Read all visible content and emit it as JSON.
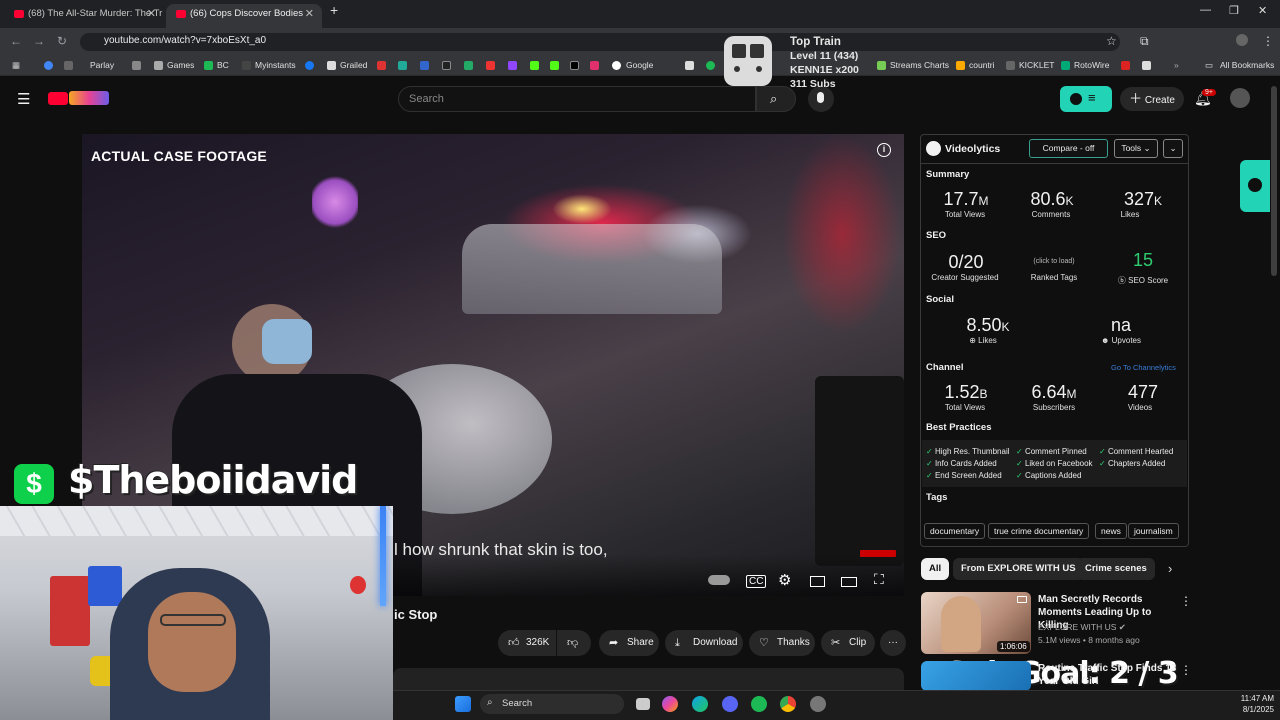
{
  "browser": {
    "tabs": [
      {
        "title": "(68) The All-Star Murder: The Tr"
      },
      {
        "title": "(66) Cops Discover Bodies"
      }
    ],
    "url": "youtube.com/watch?v=7xboEsXt_a0",
    "bookmarks": [
      "Parlay",
      "Games",
      "BC",
      "Myinstants",
      "Grailed",
      "Google",
      "Streams Charts",
      "countri",
      "KICKLET",
      "RotoWire",
      "All Bookmarks"
    ]
  },
  "overlay": {
    "train_title": "Top Train",
    "train_level": "Level 11  (434)",
    "train_user": "KENN1E x200",
    "train_subs": "311 Subs",
    "cashtag": "$Theboiidavid",
    "cashapp_symbol": "$",
    "sub_goal": "Sub Goal: 2 / 3"
  },
  "youtube": {
    "search_placeholder": "Search",
    "create_label": "Create",
    "notif_count": "9+",
    "video": {
      "case_label": "ACTUAL CASE FOOTAGE",
      "subtitle": "l how shrunk that skin is too,",
      "title_partial": "ic Stop"
    },
    "actions": {
      "likes": "326K",
      "share": "Share",
      "download": "Download",
      "thanks": "Thanks",
      "clip": "Clip"
    },
    "chips": [
      "All",
      "From EXPLORE WITH US",
      "Crime scenes"
    ],
    "recommended": [
      {
        "title": "Man Secretly Records Moments Leading Up to Killing",
        "channel": "EXPLORE WITH US",
        "meta": "5.1M views • 8 months ago",
        "duration": "1:06:06"
      },
      {
        "title": "Routine Traffic Stop Finds 13 Year Old Girl",
        "channel": "",
        "meta": "",
        "duration": ""
      }
    ]
  },
  "videolytics": {
    "brand": "Videolytics",
    "compare": "Compare - off",
    "tools": "Tools",
    "summary_h": "Summary",
    "summary": [
      {
        "value": "17.7",
        "unit": "M",
        "label": "Total Views"
      },
      {
        "value": "80.6",
        "unit": "K",
        "label": "Comments"
      },
      {
        "value": "327",
        "unit": "K",
        "label": "Likes"
      }
    ],
    "seo_h": "SEO",
    "seo": [
      {
        "value": "0/20",
        "label": "Creator Suggested"
      },
      {
        "value": "(click to load)",
        "label": "Ranked Tags"
      },
      {
        "value": "15",
        "label": "SEO Score"
      }
    ],
    "social_h": "Social",
    "social": [
      {
        "value": "8.50",
        "unit": "K",
        "label": "Likes"
      },
      {
        "value": "na",
        "unit": "",
        "label": "Upvotes"
      }
    ],
    "channel_h": "Channel",
    "channel_link": "Go To Channelytics",
    "channel": [
      {
        "value": "1.52",
        "unit": "B",
        "label": "Total Views"
      },
      {
        "value": "6.64",
        "unit": "M",
        "label": "Subscribers"
      },
      {
        "value": "477",
        "unit": "",
        "label": "Videos"
      }
    ],
    "best_h": "Best Practices",
    "best": [
      "High Res. Thumbnail",
      "Comment Pinned",
      "Comment Hearted",
      "Info Cards Added",
      "Liked on Facebook",
      "Chapters Added",
      "End Screen Added",
      "Captions Added"
    ],
    "tags_h": "Tags",
    "tags": [
      "documentary",
      "true crime documentary",
      "news",
      "journalism"
    ]
  },
  "taskbar": {
    "search": "Search",
    "time": "11:47 AM",
    "date": "8/1/2025"
  },
  "colors": {
    "accent_teal": "#22d3b5",
    "youtube_red": "#ff0033",
    "cashapp_green": "#0fd04a"
  }
}
